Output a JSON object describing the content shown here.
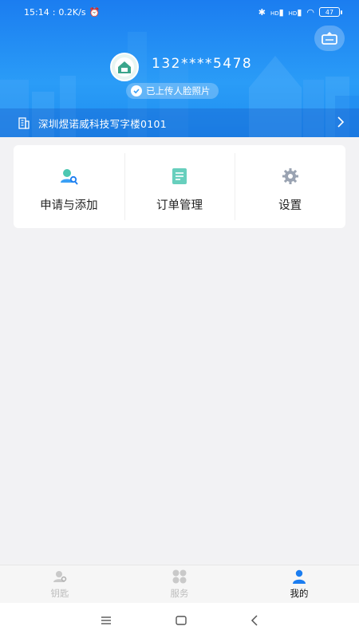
{
  "status_bar": {
    "time": "15:14",
    "speed": "0.2K/s",
    "battery": "47",
    "hd1": "HD",
    "hd2": "HD"
  },
  "header": {
    "phone": "132****5478",
    "face_status": "已上传人脸照片",
    "address": "深圳煜诺威科技写字楼0101"
  },
  "menu": {
    "items": [
      {
        "label": "申请与添加",
        "icon": "key-person-icon"
      },
      {
        "label": "订单管理",
        "icon": "document-icon"
      },
      {
        "label": "设置",
        "icon": "gear-icon"
      }
    ]
  },
  "bottom_nav": {
    "items": [
      {
        "label": "钥匙",
        "icon": "key-person-icon",
        "active": false
      },
      {
        "label": "服务",
        "icon": "grid-icon",
        "active": false
      },
      {
        "label": "我的",
        "icon": "user-icon",
        "active": true
      }
    ]
  },
  "colors": {
    "primary": "#1b7df0",
    "accent": "#3aa0f5",
    "teal": "#4cc7b1"
  }
}
